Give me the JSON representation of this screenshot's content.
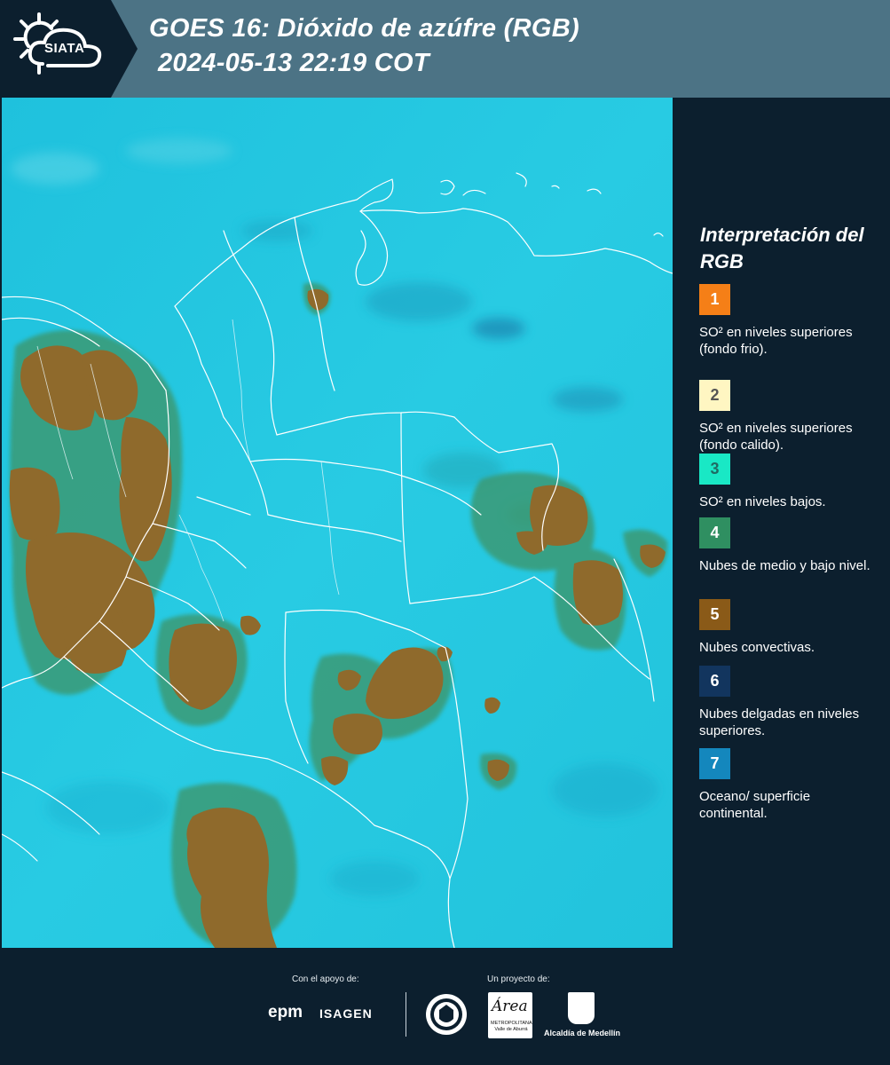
{
  "header": {
    "title_line_1": "GOES 16: Dióxido de azúfre (RGB)",
    "title_line_2": "2024-05-13 22:19 COT",
    "logo_text": "SIATA"
  },
  "legend": {
    "title": "Interpretación del RGB",
    "items": [
      {
        "number": "1",
        "text": "SO² en niveles superiores (fondo frio).",
        "color": "#f57f17",
        "number_color": "#ffffff"
      },
      {
        "number": "2",
        "text": "SO² en niveles superiores (fondo calido).",
        "color": "#fff6c2",
        "number_color": "#555555"
      },
      {
        "number": "3",
        "text": "SO² en niveles bajos.",
        "color": "#19e8c5",
        "number_color": "#1f6b63"
      },
      {
        "number": "4",
        "text": "Nubes de medio y bajo nivel.",
        "color": "#2f8f61",
        "number_color": "#ffffff"
      },
      {
        "number": "5",
        "text": "Nubes convectivas.",
        "color": "#8a5a18",
        "number_color": "#ffffff"
      },
      {
        "number": "6",
        "text": "Nubes delgadas en niveles superiores.",
        "color": "#12355e",
        "number_color": "#ffffff"
      },
      {
        "number": "7",
        "text": "Oceano/ superficie continental.",
        "color": "#1487bd",
        "number_color": "#ffffff"
      }
    ]
  },
  "footer": {
    "support_label": "Con el apoyo de:",
    "project_label": "Un proyecto de:",
    "sponsor_logos": [
      "epm",
      "ISAGEN"
    ],
    "project_logos": [
      "Área Metropolitana Valle de Aburrá",
      "Alcaldía de Medellín"
    ],
    "epm_text": "epm",
    "isagen_text": "ISAGEN",
    "area_script": "Área",
    "area_sub": "METROPOLITANA Valle de Aburrá",
    "alcaldia_text": "Alcaldía de Medellín"
  },
  "map": {
    "background_color": "#25c8e2",
    "convective_color": "#8c6a2a",
    "border_color": "#ffffff"
  }
}
